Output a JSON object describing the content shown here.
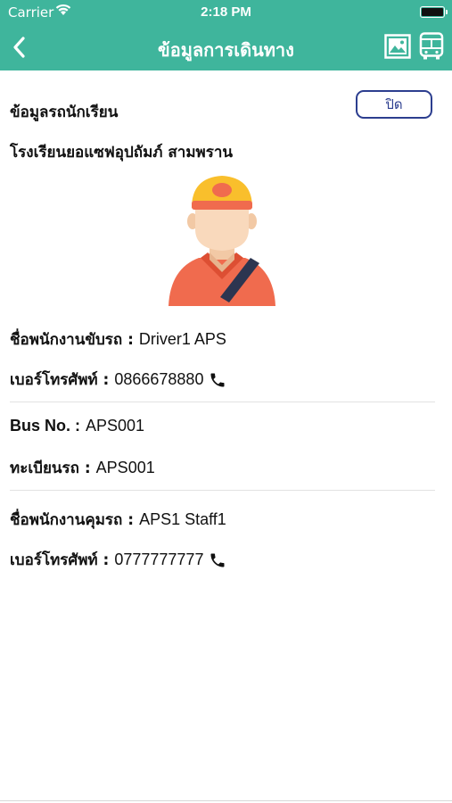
{
  "status_bar": {
    "carrier": "Carrier",
    "time": "2:18 PM"
  },
  "nav": {
    "title": "ข้อมูลการเดินทาง",
    "back_icon": "chevron-left-icon",
    "photo_icon": "image-icon",
    "bus_icon": "bus-icon"
  },
  "info": {
    "section_title": "ข้อมูลรถนักเรียน",
    "close_label": "ปิด",
    "school_name": "โรงเรียนยอแซฟอุปถัมภ์ สามพราน"
  },
  "driver": {
    "name_label": "ชื่อพนักงานขับรถ :",
    "name_value": "Driver1 APS",
    "phone_label": "เบอร์โทรศัพท์ :",
    "phone_value": "0866678880"
  },
  "bus": {
    "number_label": "Bus No. :",
    "number_value": "APS001",
    "plate_label": "ทะเบียนรถ :",
    "plate_value": "APS001"
  },
  "staff": {
    "name_label": "ชื่อพนักงานคุมรถ :",
    "name_value": "APS1 Staff1",
    "phone_label": "เบอร์โทรศัพท์ :",
    "phone_value": "0777777777"
  },
  "colors": {
    "header": "#3fb59c",
    "button_border": "#2c3e8f"
  }
}
